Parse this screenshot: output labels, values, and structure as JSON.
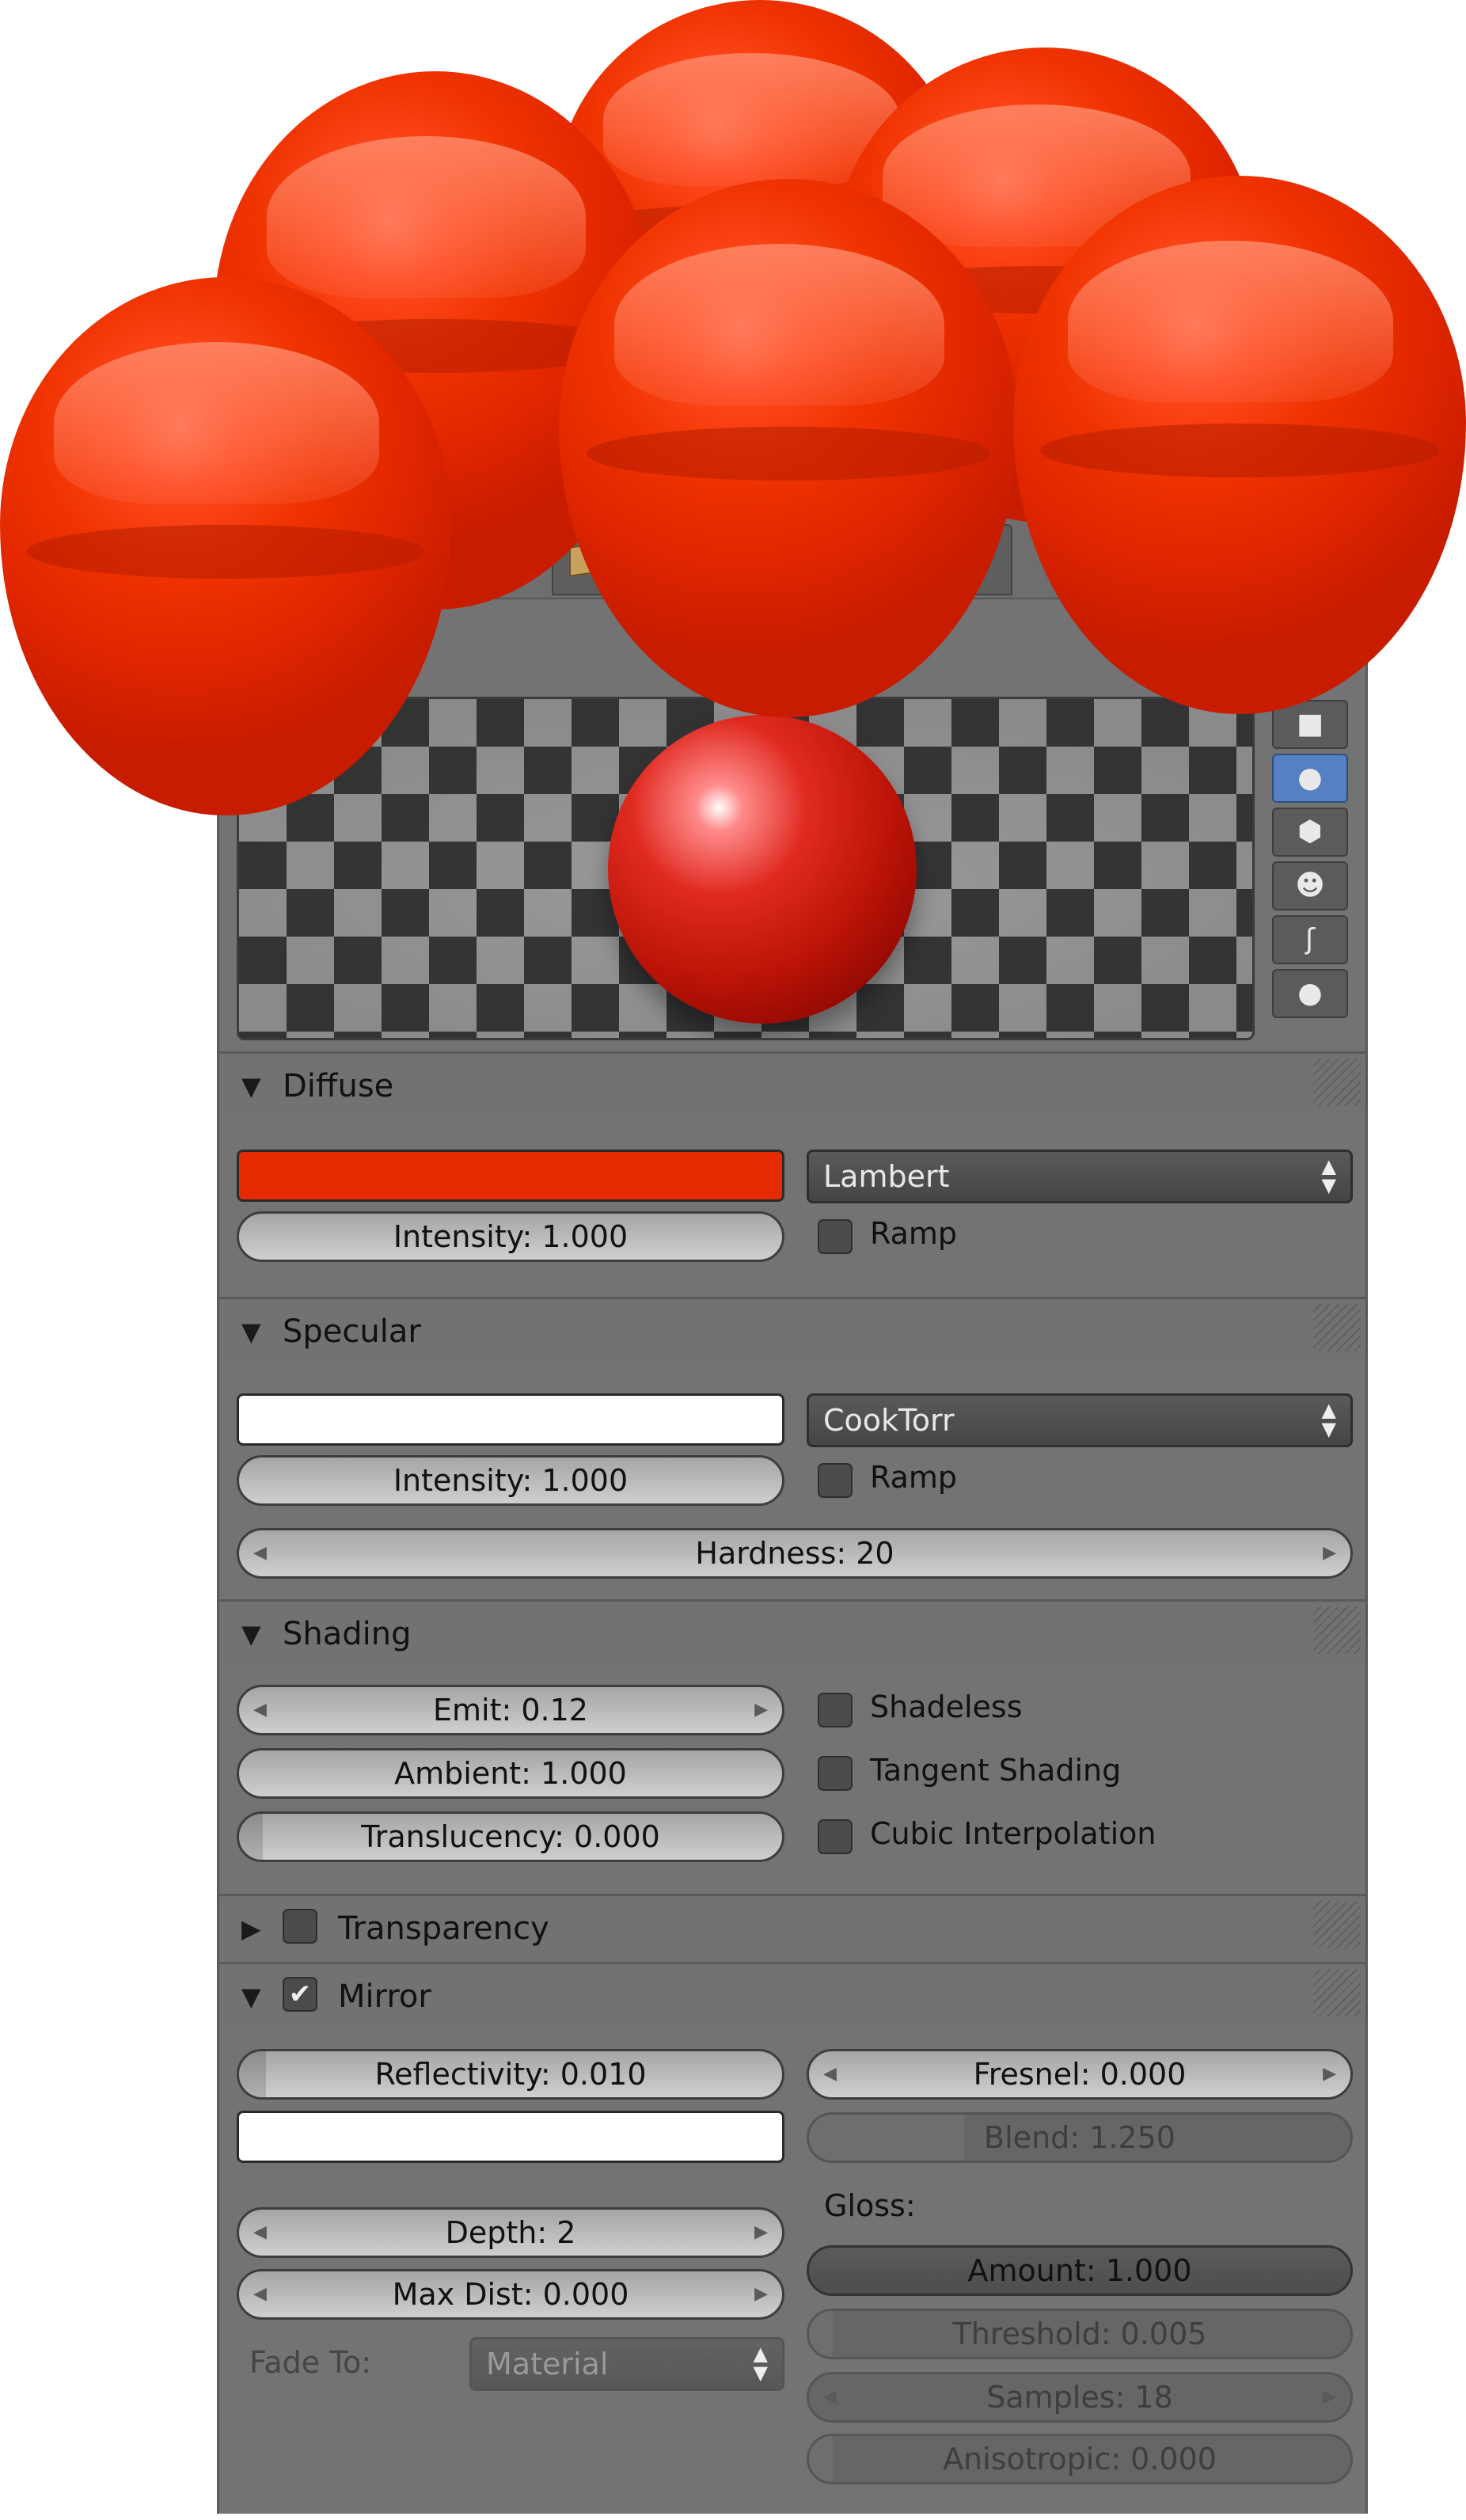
{
  "diffuse": {
    "title": "Diffuse",
    "color": "#e52a00",
    "shader": "Lambert",
    "intensity": "Intensity: 1.000",
    "ramp": "Ramp"
  },
  "specular": {
    "title": "Specular",
    "color": "#ffffff",
    "shader": "CookTorr",
    "intensity": "Intensity: 1.000",
    "ramp": "Ramp",
    "hardness": "Hardness: 20"
  },
  "shading": {
    "title": "Shading",
    "emit": "Emit: 0.12",
    "ambient": "Ambient: 1.000",
    "translucency": "Translucency: 0.000",
    "shadeless": "Shadeless",
    "tangent": "Tangent Shading",
    "cubic": "Cubic Interpolation"
  },
  "transparency": {
    "title": "Transparency",
    "enabled": false
  },
  "mirror": {
    "title": "Mirror",
    "enabled": true,
    "reflectivity": "Reflectivity: 0.010",
    "fresnel": "Fresnel: 0.000",
    "blend": "Blend: 1.250",
    "color": "#ffffff",
    "depth": "Depth: 2",
    "max_dist": "Max Dist: 0.000",
    "gloss_label": "Gloss:",
    "amount": "Amount: 1.000",
    "threshold": "Threshold: 0.005",
    "samples": "Samples: 18",
    "anisotropic": "Anisotropic: 0.000",
    "fade_to_label": "Fade To:",
    "fade_to_value": "Material"
  },
  "preview_types": [
    "plane-icon",
    "sphere-icon",
    "cube-icon",
    "monkey-icon",
    "hair-icon",
    "sky-icon"
  ],
  "preview_selected": 1,
  "colors": {
    "ball": "#ef3300",
    "panel": "#737373",
    "selected": "#5680c2"
  }
}
